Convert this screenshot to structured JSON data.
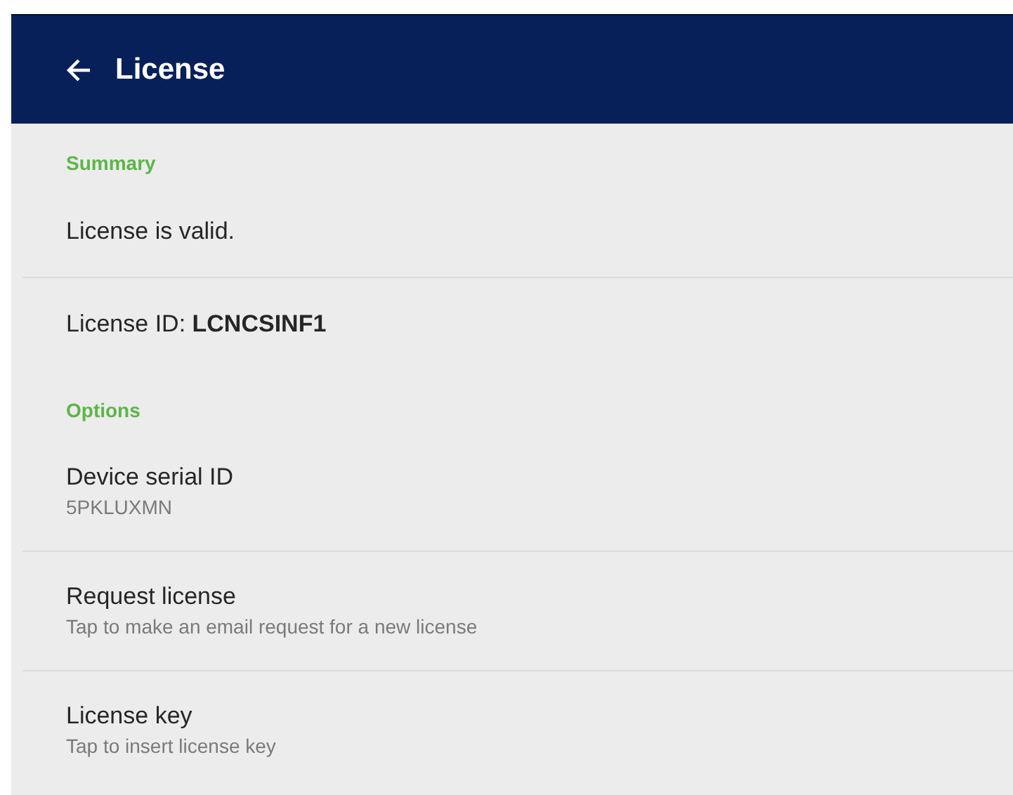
{
  "app_bar": {
    "title": "License"
  },
  "sections": [
    {
      "header": "Summary",
      "items": [
        {
          "kind": "text",
          "title": "License is valid.",
          "divider": true
        },
        {
          "kind": "text",
          "title": "License ID: **LCNCSINF1**",
          "divider": false
        }
      ]
    },
    {
      "header": "Options",
      "items": [
        {
          "kind": "two-line",
          "title": "Device serial ID",
          "subtitle": "5PKLUXMN",
          "divider": true
        },
        {
          "kind": "two-line",
          "title": "Request license",
          "subtitle": "Tap to make an email request for a new license",
          "divider": true
        },
        {
          "kind": "two-line",
          "title": "License key",
          "subtitle": "Tap to insert license key",
          "divider": false
        }
      ]
    }
  ]
}
